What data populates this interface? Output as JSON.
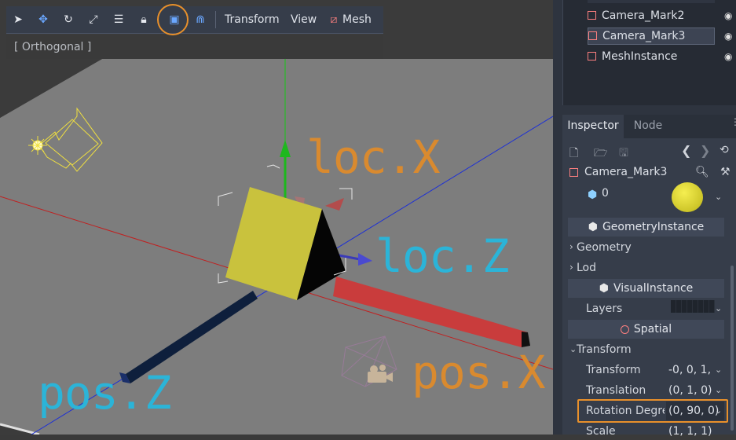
{
  "viewport": {
    "toolbar": {
      "menus": [
        "Transform",
        "View",
        "Mesh"
      ],
      "icons": [
        "select-icon",
        "move-icon",
        "rotate-icon",
        "scale-icon",
        "list-select-icon",
        "lock-icon",
        "local-space-icon",
        "snap-icon",
        "mesh-icon"
      ]
    },
    "mode_label": "[ Orthogonal ]",
    "annotations": {
      "loc_x": "loc.X",
      "loc_z": "loc.Z",
      "pos_x": "pos.X",
      "pos_z": "pos.Z"
    },
    "colors": {
      "loc_x": "#d98a2f",
      "loc_z": "#2bb4d8",
      "pos_x": "#d98a2f",
      "pos_z": "#2bb4d8",
      "highlight": "#e8902b"
    }
  },
  "scene_tree": {
    "items": [
      {
        "label": "Camera_Mark2",
        "selected": false
      },
      {
        "label": "Camera_Mark3",
        "selected": true
      },
      {
        "label": "MeshInstance",
        "selected": false
      }
    ]
  },
  "inspector": {
    "tabs": [
      "Inspector",
      "Node"
    ],
    "node_name": "Camera_Mark3",
    "material_index": "0",
    "sections": {
      "geometry_instance": "GeometryInstance",
      "visual_instance": "VisualInstance",
      "spatial": "Spatial"
    },
    "groups": {
      "geometry": "Geometry",
      "lod": "Lod",
      "transform": "Transform"
    },
    "props": {
      "layers": "Layers",
      "transform_label": "Transform",
      "transform_value": "-0, 0, 1,",
      "translation_label": "Translation",
      "translation_value": "(0, 1, 0)",
      "rotation_label": "Rotation Degre",
      "rotation_value": "(0, 90, 0)",
      "scale_label": "Scale",
      "scale_value": "(1, 1, 1)"
    }
  }
}
